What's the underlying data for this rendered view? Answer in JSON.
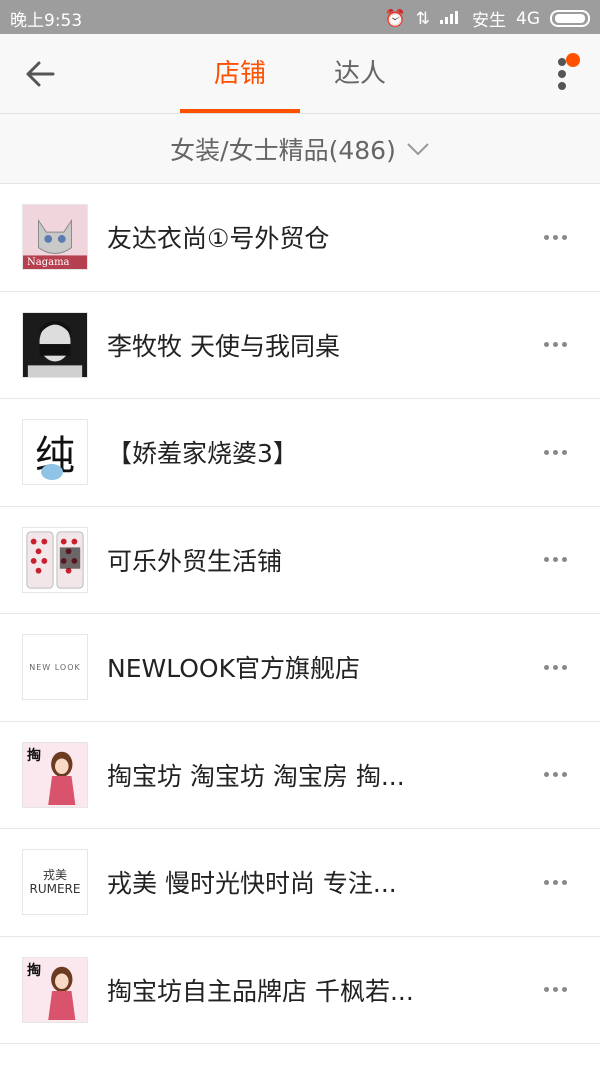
{
  "status_bar": {
    "time": "晚上9:53",
    "carrier": "安生",
    "network": "4G"
  },
  "header": {
    "tabs": [
      {
        "label": "店铺",
        "active": true
      },
      {
        "label": "达人",
        "active": false
      }
    ],
    "accent_color": "#ff5000"
  },
  "filter": {
    "label": "女装/女士精品(486)"
  },
  "shops": [
    {
      "name": "友达衣尚①号外贸仓",
      "avatar_text": "Nagama"
    },
    {
      "name": "李牧牧 天使与我同桌",
      "avatar_text": ""
    },
    {
      "name": "【娇羞家烧婆3】",
      "avatar_text": "纯"
    },
    {
      "name": "可乐外贸生活铺",
      "avatar_text": ""
    },
    {
      "name": "NEWLOOK官方旗舰店",
      "avatar_text": "NEW LOOK"
    },
    {
      "name": "掏宝坊 淘宝坊 淘宝房 掏...",
      "avatar_text": "掏"
    },
    {
      "name": "戎美 慢时光快时尚 专注...",
      "avatar_text": "戎美 RUMERE"
    },
    {
      "name": "掏宝坊自主品牌店 千枫若...",
      "avatar_text": "掏"
    }
  ]
}
